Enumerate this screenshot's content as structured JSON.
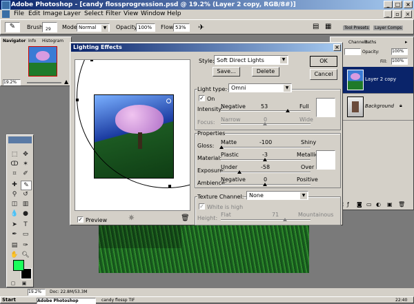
{
  "app": {
    "title": "Adobe Photoshop - [candy flossprogression.psd @ 19.2% (Layer 2 copy, RGB/8#)]",
    "menu": [
      "File",
      "Edit",
      "Image",
      "Layer",
      "Select",
      "Filter",
      "View",
      "Window",
      "Help"
    ]
  },
  "options_bar": {
    "brush_label": "Brush:",
    "brush_size": "29",
    "mode_label": "Mode:",
    "mode_value": "Normal",
    "opacity_label": "Opacity:",
    "opacity_value": "100%",
    "flow_label": "Flow:",
    "flow_value": "53%",
    "tab_tool_presets": "Tool Presets",
    "tab_layer_comps": "Layer Comps"
  },
  "navigator": {
    "tabs": [
      "Navigator",
      "Info",
      "Histogram"
    ],
    "zoom": "19.2%"
  },
  "status": {
    "doc": "Doc: 22.8M/53.3M"
  },
  "layers": {
    "tabs": [
      "Channels",
      "Paths"
    ],
    "opacity_label": "Opacity:",
    "opacity_value": "100%",
    "fill_label": "Fill:",
    "fill_value": "100%",
    "items": [
      {
        "name": "Layer 2 copy",
        "selected": true
      },
      {
        "name": "Background",
        "selected": false
      }
    ]
  },
  "dialog": {
    "title": "Lighting Effects",
    "style_label": "Style:",
    "style_value": "Soft Direct Lights",
    "save_label": "Save...",
    "delete_label": "Delete",
    "ok_label": "OK",
    "cancel_label": "Cancel",
    "light_type_label": "Light type:",
    "light_type_value": "Omni",
    "on_label": "On",
    "on_checked": true,
    "intensity": {
      "label": "Intensity:",
      "left": "Negative",
      "value": "53",
      "right": "Full"
    },
    "focus": {
      "label": "Focus:",
      "left": "Narrow",
      "value": "0",
      "right": "Wide"
    },
    "properties_label": "Properties",
    "gloss": {
      "label": "Gloss:",
      "left": "Matte",
      "value": "-100",
      "right": "Shiny"
    },
    "material": {
      "label": "Material:",
      "left": "Plastic",
      "value": "-3",
      "right": "Metallic"
    },
    "exposure": {
      "label": "Exposure:",
      "left": "Under",
      "value": "-58",
      "right": "Over"
    },
    "ambience": {
      "label": "Ambience:",
      "left": "Negative",
      "value": "0",
      "right": "Positive"
    },
    "texture_label": "Texture Channel:",
    "texture_value": "None",
    "white_high_label": "White is high",
    "height": {
      "label": "Height:",
      "left": "Flat",
      "value": "71",
      "right": "Mountainous"
    },
    "preview_label": "Preview",
    "preview_checked": true
  },
  "taskbar": {
    "start": "Start",
    "items": [
      "Adobe Photoshop",
      "candy flossp TIF"
    ],
    "clock": "22:40"
  },
  "colors": {
    "accent": "#0a246a",
    "foreground_swatch": "#1aff5a",
    "background_swatch": "#000000"
  }
}
